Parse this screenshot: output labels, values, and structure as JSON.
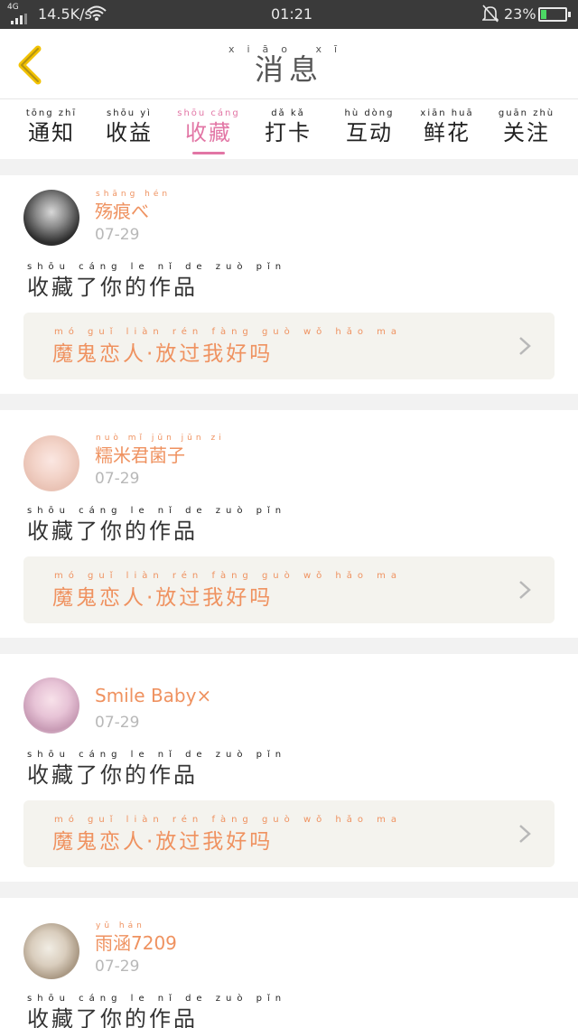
{
  "status_bar": {
    "network": "4G",
    "speed": "14.5K/s",
    "time": "01:21",
    "battery_pct": "23%",
    "battery_level": 0.23,
    "icons": [
      "signal-icon",
      "wifi-icon",
      "bell-muted-icon",
      "battery-icon"
    ]
  },
  "header": {
    "title": "消息",
    "title_pinyin": "xiāo xī",
    "back_icon": "chevron-left-icon",
    "accent": "#f2c200"
  },
  "tabs": [
    {
      "label": "通知",
      "pinyin": "tōng zhī"
    },
    {
      "label": "收益",
      "pinyin": "shōu yì"
    },
    {
      "label": "收藏",
      "pinyin": "shōu cáng",
      "active": true
    },
    {
      "label": "打卡",
      "pinyin": "dǎ kǎ"
    },
    {
      "label": "互动",
      "pinyin": "hù dòng"
    },
    {
      "label": "鲜花",
      "pinyin": "xiān huā"
    },
    {
      "label": "关注",
      "pinyin": "guān zhù"
    }
  ],
  "colors": {
    "accent_pink": "#e276a5",
    "name_orange": "#ef9260",
    "box_bg": "#f4f3ee"
  },
  "messages": [
    {
      "user": "殇痕べ",
      "user_pinyin": "shāng hén",
      "date": "07-29",
      "action": "收藏了你的作品",
      "action_pinyin": "shōu cáng le nǐ de zuò pǐn",
      "work": "魔鬼恋人·放过我好吗",
      "work_pinyin": "mó guǐ liàn rén fàng guò wǒ hǎo ma"
    },
    {
      "user": "糯米君菌子",
      "user_pinyin": "nuò mǐ jūn jūn zi",
      "date": "07-29",
      "action": "收藏了你的作品",
      "action_pinyin": "shōu cáng le nǐ de zuò pǐn",
      "work": "魔鬼恋人·放过我好吗",
      "work_pinyin": "mó guǐ liàn rén fàng guò wǒ hǎo ma"
    },
    {
      "user": "Smile Baby×",
      "user_pinyin": "",
      "date": "07-29",
      "action": "收藏了你的作品",
      "action_pinyin": "shōu cáng le nǐ de zuò pǐn",
      "work": "魔鬼恋人·放过我好吗",
      "work_pinyin": "mó guǐ liàn rén fàng guò wǒ hǎo ma"
    },
    {
      "user": "雨涵7209",
      "user_pinyin": "yǔ hán",
      "date": "07-29",
      "action": "收藏了你的作品",
      "action_pinyin": "shōu cáng le nǐ de zuò pǐn"
    }
  ]
}
